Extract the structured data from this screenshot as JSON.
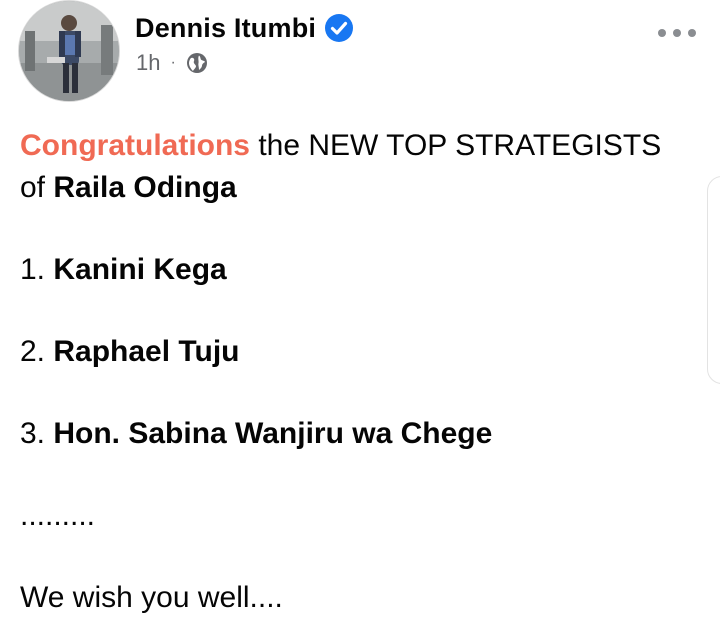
{
  "post": {
    "author": {
      "name": "Dennis Itumbi",
      "verified_icon": "verified-badge-icon",
      "avatar_icon": "profile-photo"
    },
    "meta": {
      "time": "1h",
      "separator": "·",
      "audience_icon": "globe-icon"
    },
    "menu_icon": "more-options-icon",
    "body": {
      "congrats": "Congratulations",
      "line1_rest": " the NEW TOP STRATEGISTS",
      "line2_of": "of ",
      "line2_name": "Raila Odinga",
      "item1_num": "1. ",
      "item1_name": "Kanini Kega",
      "item2_num": "2. ",
      "item2_name": "Raphael Tuju",
      "item3_num": "3. ",
      "item3_name": "Hon. Sabina Wanjiru wa Chege",
      "ellipsis": ".........",
      "closing": "We wish you well...."
    }
  },
  "colors": {
    "highlight": "#f06a54",
    "verified": "#1877f2",
    "meta_text": "#65676b",
    "text": "#050505"
  }
}
